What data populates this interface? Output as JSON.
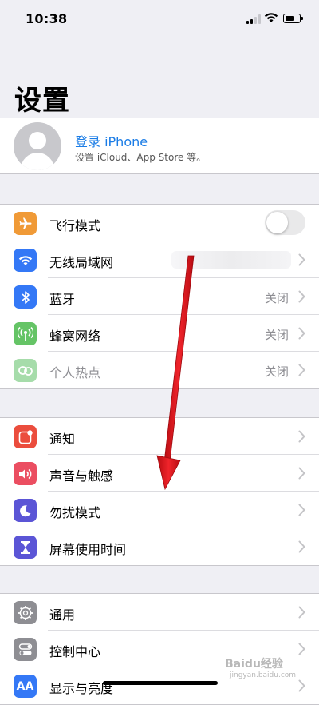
{
  "status_bar": {
    "time": "10:38"
  },
  "page": {
    "title": "设置"
  },
  "profile": {
    "title": "登录 iPhone",
    "subtitle": "设置 iCloud、App Store 等。"
  },
  "group1": [
    {
      "label": "飞行模式",
      "icon": "airplane-icon",
      "color": "#f09a37",
      "toggle": "off"
    },
    {
      "label": "无线局域网",
      "icon": "wifi-icon",
      "color": "#3478f6"
    },
    {
      "label": "蓝牙",
      "icon": "bluetooth-icon",
      "color": "#3478f6",
      "value": "关闭"
    },
    {
      "label": "蜂窝网络",
      "icon": "cellular-icon",
      "color": "#65c466",
      "value": "关闭"
    },
    {
      "label": "个人热点",
      "icon": "hotspot-icon",
      "color": "#a6dcaa",
      "value": "关闭"
    }
  ],
  "group2": [
    {
      "label": "通知",
      "icon": "notifications-icon",
      "color": "#eb4d3d"
    },
    {
      "label": "声音与触感",
      "icon": "sound-icon",
      "color": "#eb4e61"
    },
    {
      "label": "勿扰模式",
      "icon": "moon-icon",
      "color": "#5b55d6"
    },
    {
      "label": "屏幕使用时间",
      "icon": "hourglass-icon",
      "color": "#5b55d6"
    }
  ],
  "group3": [
    {
      "label": "通用",
      "icon": "gear-icon",
      "color": "#8e8e93"
    },
    {
      "label": "控制中心",
      "icon": "control-center-icon",
      "color": "#8e8e93"
    },
    {
      "label": "显示与亮度",
      "icon": "display-brightness-icon",
      "color": "#3478f6",
      "icon_text": "AA"
    }
  ],
  "annotation": {
    "color": "#e8141c"
  },
  "watermark": {
    "text": "Baidu经验",
    "sub": "jingyan.baidu.com"
  }
}
